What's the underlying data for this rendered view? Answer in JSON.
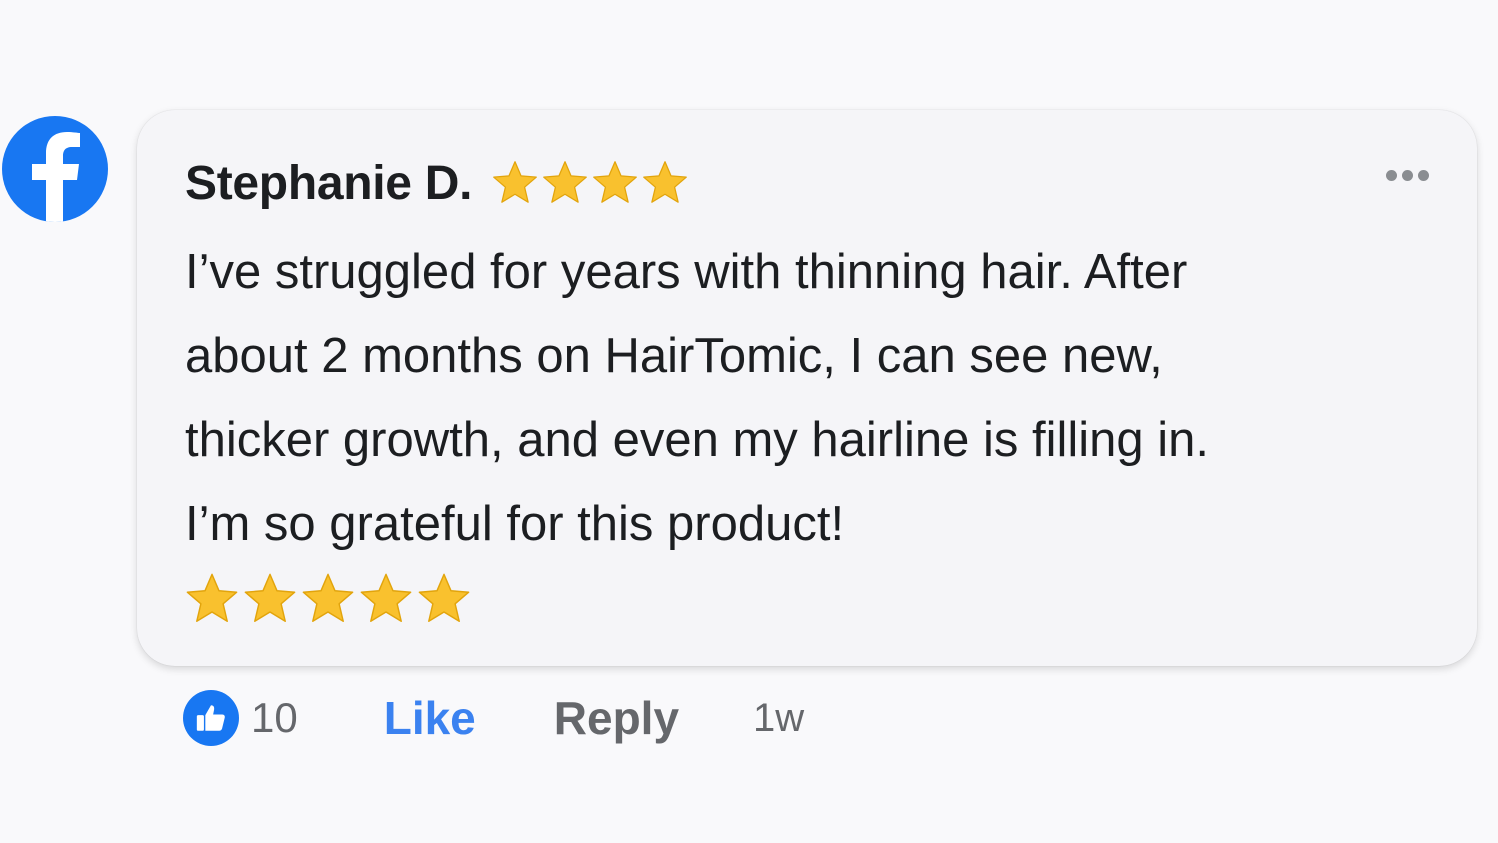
{
  "brand": {
    "icon": "facebook-logo-icon",
    "color": "#1877f2"
  },
  "comment": {
    "author": "Stephanie D.",
    "author_rating": 4,
    "text_lines": [
      "I’ve struggled for years with thinning hair. After",
      "about 2 months on HairTomic, I can see new,",
      "thicker growth, and even my hairline is filling in.",
      "I’m so grateful for this product!"
    ],
    "bottom_rating": 5,
    "star_color": "#f9c12e"
  },
  "footer": {
    "like_count": "10",
    "like_label": "Like",
    "reply_label": "Reply",
    "timestamp": "1w",
    "like_color": "#3b82f0"
  }
}
